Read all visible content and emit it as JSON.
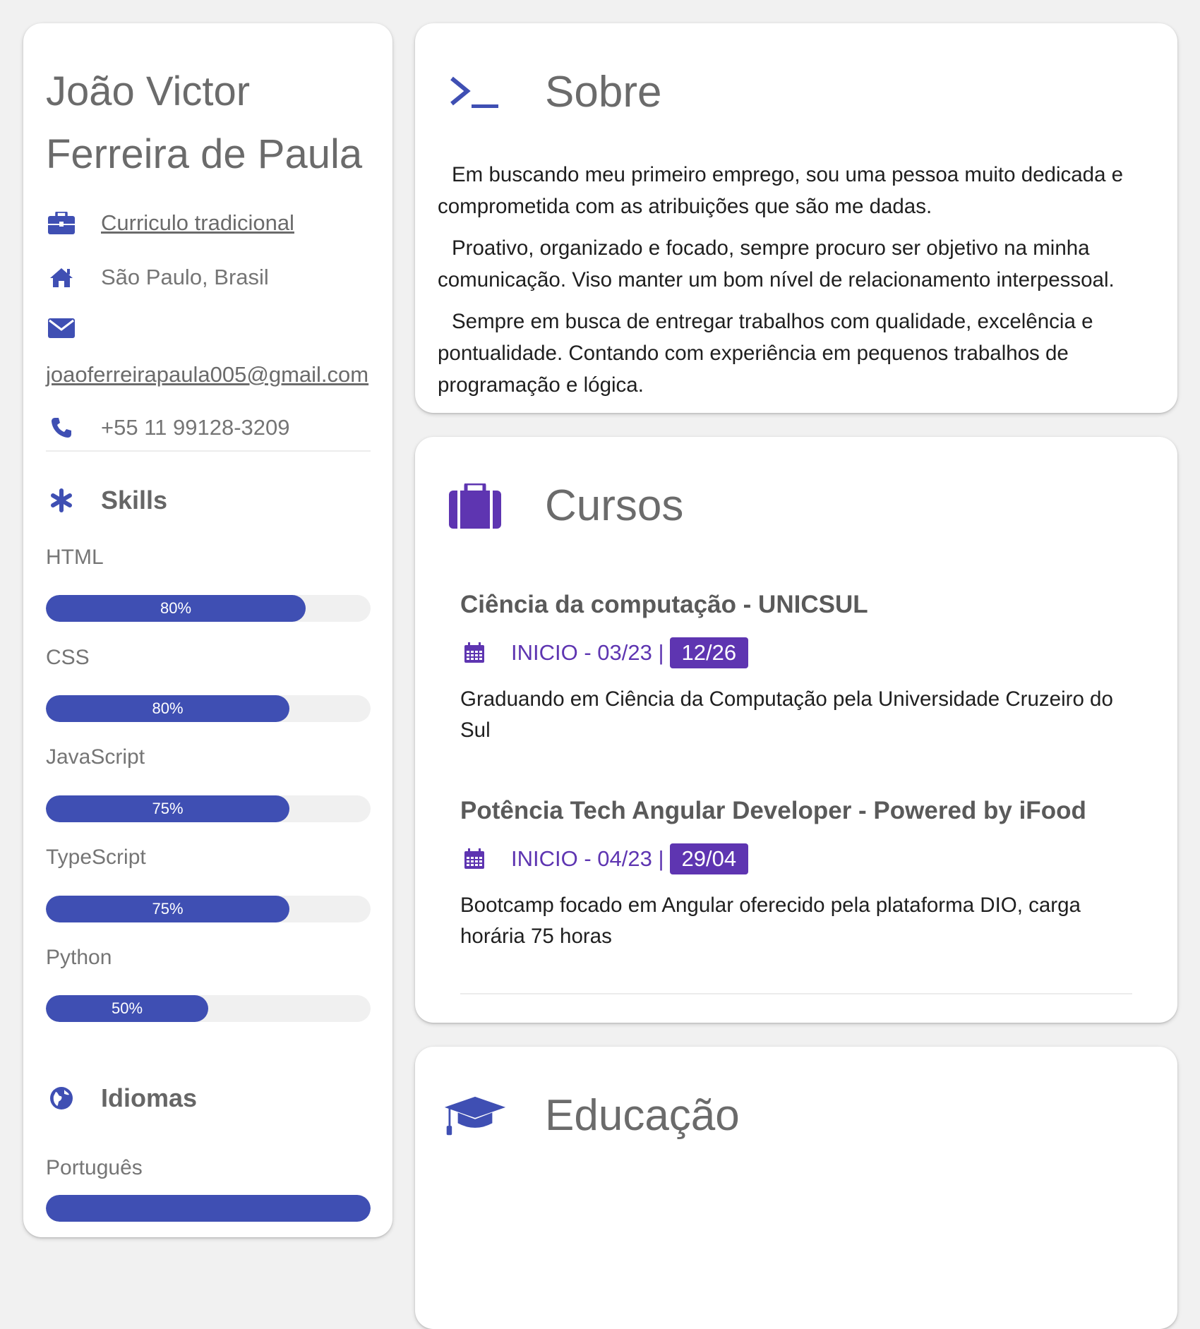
{
  "profile": {
    "name": "João Victor Ferreira de Paula",
    "resume_link": "Curriculo tradicional",
    "location": "São Paulo, Brasil",
    "email": "joaoferreirapaula005@gmail.com",
    "phone": "+55 11 99128-3209"
  },
  "skills": {
    "title": "Skills",
    "items": [
      {
        "name": "HTML",
        "percent_label": "80%",
        "fill_percent": 80
      },
      {
        "name": "CSS",
        "percent_label": "80%",
        "fill_percent": 75
      },
      {
        "name": "JavaScript",
        "percent_label": "75%",
        "fill_percent": 75
      },
      {
        "name": "TypeScript",
        "percent_label": "75%",
        "fill_percent": 75
      },
      {
        "name": "Python",
        "percent_label": "50%",
        "fill_percent": 50
      }
    ]
  },
  "languages": {
    "title": "Idiomas",
    "items": [
      {
        "name": "Português"
      }
    ]
  },
  "about": {
    "title": "Sobre",
    "paragraphs": [
      "Em buscando meu primeiro emprego, sou uma pessoa muito dedicada e comprometida com as atribuições que são me dadas.",
      "Proativo, organizado e focado, sempre procuro ser objetivo na minha comunicação. Viso manter um bom nível de relacionamento interpessoal.",
      "Sempre em busca de entregar trabalhos com qualidade, excelência e pontualidade. Contando com experiência em pequenos trabalhos de programação e lógica."
    ]
  },
  "courses": {
    "title": "Cursos",
    "items": [
      {
        "title": "Ciência da computação - UNICSUL",
        "start": "INICIO - 03/23 |",
        "end": "12/26",
        "description": "Graduando em Ciência da Computação pela Universidade Cruzeiro do Sul"
      },
      {
        "title": "Potência Tech Angular Developer - Powered by iFood",
        "start": "INICIO - 04/23 |",
        "end": "29/04",
        "description": "Bootcamp focado em Angular oferecido pela plataforma DIO, carga horária 75 horas"
      }
    ]
  },
  "education": {
    "title": "Educação"
  },
  "colors": {
    "primary": "#3f4fb3",
    "accent_purple": "#5e35b1",
    "background": "#f1f1f1"
  }
}
